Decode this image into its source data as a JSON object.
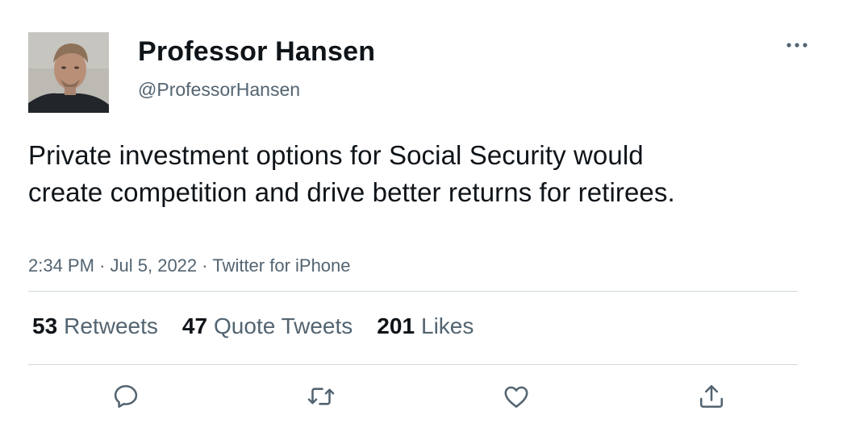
{
  "tweet": {
    "display_name": "Professor Hansen",
    "handle": "@ProfessorHansen",
    "text": "Private investment options for Social Security would create competition and drive better returns for retirees.",
    "time": "2:34 PM",
    "date": "Jul 5, 2022",
    "source": "Twitter for iPhone",
    "separator": "·"
  },
  "stats": {
    "retweets_count": "53",
    "retweets_label": "Retweets",
    "quotes_count": "47",
    "quotes_label": "Quote Tweets",
    "likes_count": "201",
    "likes_label": "Likes"
  },
  "actions": [
    {
      "icon": "reply-icon"
    },
    {
      "icon": "retweet-icon"
    },
    {
      "icon": "like-icon"
    },
    {
      "icon": "share-icon"
    }
  ],
  "colors": {
    "text": "#0f1419",
    "secondary": "#536471",
    "divider": "#cfd9de"
  }
}
